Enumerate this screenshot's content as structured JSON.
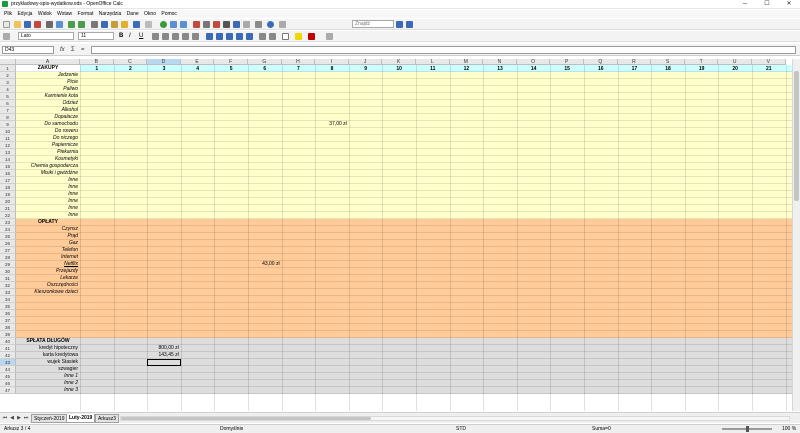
{
  "window": {
    "title": "przykladowy-spis-wydatkow.ods - OpenOffice Calc",
    "minimize": "─",
    "maximize": "☐",
    "close": "✕"
  },
  "menu": [
    "Plik",
    "Edycja",
    "Widok",
    "Wstaw",
    "Format",
    "Narzędzia",
    "Dane",
    "Okno",
    "Pomoc"
  ],
  "toolbar": {
    "search_placeholder": "Znajdź",
    "font_name": "Lato",
    "font_size": "11"
  },
  "formula_bar": {
    "cell_reference": "D43",
    "fx": "fx",
    "sum": "Σ",
    "equals": "=",
    "content": ""
  },
  "columns": [
    "A",
    "B",
    "C",
    "D",
    "E",
    "F",
    "G",
    "H",
    "I",
    "J",
    "K",
    "L",
    "M",
    "N",
    "O",
    "P",
    "Q",
    "R",
    "S",
    "T",
    "U",
    "V"
  ],
  "day_numbers": [
    "1",
    "2",
    "3",
    "4",
    "5",
    "6",
    "7",
    "8",
    "9",
    "10",
    "11",
    "12",
    "13",
    "14",
    "15",
    "16",
    "17",
    "18",
    "19",
    "20",
    "21"
  ],
  "rows": [
    "1",
    "2",
    "3",
    "4",
    "5",
    "6",
    "7",
    "8",
    "9",
    "10",
    "11",
    "12",
    "13",
    "14",
    "15",
    "16",
    "17",
    "18",
    "19",
    "20",
    "21",
    "22",
    "23",
    "24",
    "25",
    "26",
    "27",
    "28",
    "29",
    "30",
    "31",
    "32",
    "33",
    "34",
    "35",
    "36",
    "37",
    "38",
    "39",
    "40",
    "41",
    "42",
    "43",
    "44",
    "45",
    "46",
    "47"
  ],
  "sections": {
    "zakupy": "ZAKUPY",
    "oplaty": "OPŁATY",
    "splata": "SPŁATA DŁUGÓW"
  },
  "zakupy_items": [
    "Jedzenie",
    "Picie",
    "Paliwo",
    "Karmienie kota",
    "Odzież",
    "Alkohol",
    "Dopalacze",
    "Do samochodu",
    "Do roweru",
    "Do niczego",
    "Papiernicze",
    "Piekarnia",
    "Kosmetyki",
    "Chemia gospodarcza",
    "Misiki i gwiżdżne",
    "Inne",
    "Inne",
    "Inne",
    "Inne",
    "Inne",
    "Inne"
  ],
  "oplaty_items": [
    "Czynsz",
    "Prąd",
    "Gaz",
    "Telefon",
    "Internet",
    "Netflix",
    "Przejazdy",
    "Lekarze",
    "Oszczędności",
    "Kieszonkowe dzieci"
  ],
  "splata_items": [
    "kredyt hipoteczny",
    "karta kredytowa",
    "wujek Stasiek",
    "szwagier",
    "Inne 1",
    "Inne 2",
    "Inne 3"
  ],
  "cell_values": {
    "zakupy_do_samochodu_day7": "37,00 zł",
    "oplaty_netflix_day5": "43,00 zł",
    "kredyt_hipoteczny_day2": "800,00 zł",
    "karta_kredytowa_day2": "143,45 zł"
  },
  "sheet_tabs": [
    "Styczeń-2019",
    "Luty-2019",
    "Arkusz3"
  ],
  "active_tab": "Luty-2019",
  "status": {
    "sheet": "Arkusz 3 / 4",
    "style": "Domyślnie",
    "mode": "STD",
    "sum": "Suma=0",
    "zoom": "100 %"
  },
  "colors": {
    "zakupy": "#ffffcc",
    "oplaty": "#ffcc99",
    "splata": "#dddddd",
    "day_header": "#ccffff",
    "selected_col_header": "#b9d7ef"
  }
}
